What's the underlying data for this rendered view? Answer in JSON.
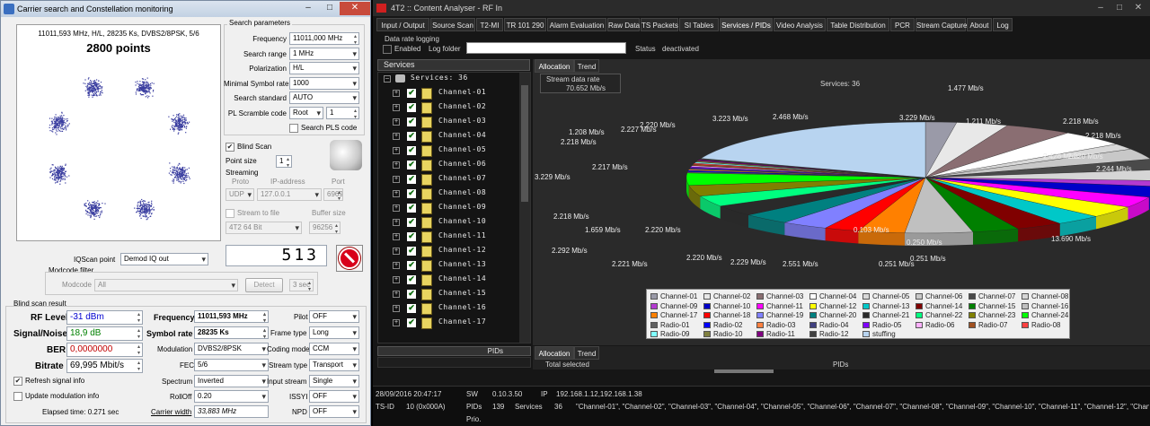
{
  "left": {
    "title": "Carrier search and Constellation monitoring",
    "constellation": {
      "header": "11011,593 MHz, H/L, 28235 Ks, DVBS2/8PSK, 5/6",
      "points_label": "2800 points"
    },
    "search_params": {
      "title": "Search parameters",
      "frequency_label": "Frequency",
      "frequency": "11011,000 MHz",
      "range_label": "Search range",
      "range": "1 MHz",
      "polarization_label": "Polarization",
      "polarization": "H/L",
      "min_sr_label": "Minimal Symbol rate",
      "min_sr": "1000",
      "standard_label": "Search standard",
      "standard": "AUTO",
      "pls_label": "PL Scramble code",
      "pls_mode": "Root",
      "pls_value": "1",
      "search_pls": "Search PLS code"
    },
    "blind_scan_label": "Blind Scan",
    "point_size_label": "Point size",
    "point_size": "1",
    "streaming": {
      "title": "Streaming",
      "proto_label": "Proto",
      "ip_label": "IP-address",
      "port_label": "Port",
      "proto": "UDP",
      "ip": "127.0.0.1",
      "port": "6969",
      "stream_to_file": "Stream to file",
      "buffer_label": "Buffer size",
      "format": "4T2 64 Bit",
      "buffer": "96256"
    },
    "counter": "513",
    "iq_label": "IQScan point",
    "iq_value": "Demod IQ out",
    "modcode": {
      "title": "Modcode filter",
      "label": "Modcode",
      "value": "All",
      "detect": "Detect",
      "interval": "3 sec"
    },
    "result": {
      "title": "Blind scan result",
      "rf_label": "RF Level",
      "rf": "-31 dBm",
      "sn_label": "Signal/Noise",
      "sn": "18,9 dB",
      "ber_label": "BER",
      "ber": "0,0000000",
      "bitrate_label": "Bitrate",
      "bitrate": "69,995 Mbit/s",
      "freq_label": "Frequency",
      "freq": "11011,593 MHz",
      "sr_label": "Symbol rate",
      "sr": "28235 Ks",
      "mod_label": "Modulation",
      "mod": "DVBS2/8PSK",
      "fec_label": "FEC",
      "fec": "5/6",
      "spectrum_label": "Spectrum",
      "spectrum": "Inverted",
      "rolloff_label": "RollOff",
      "rolloff": "0.20",
      "cw_label": "Carrier width",
      "cw": "33,883 MHz",
      "pilot_label": "Pilot",
      "pilot": "OFF",
      "frame_label": "Frame type",
      "frame": "Long",
      "coding_label": "Coding mode",
      "coding": "CCM",
      "stype_label": "Stream type",
      "stype": "Transport",
      "istream_label": "Input stream",
      "istream": "Single",
      "issyi_label": "ISSYI",
      "issyi": "OFF",
      "npd_label": "NPD",
      "npd": "OFF"
    },
    "refresh_label": "Refresh signal info",
    "update_mod_label": "Update modulation info",
    "elapsed": "Elapsed time: 0.271 sec"
  },
  "right": {
    "title": "4T2 :: Content Analyser - RF In",
    "tabs": [
      "Input / Output",
      "Source Scan",
      "T2-MI",
      "TR 101 290",
      "Alarm Evaluation",
      "Raw Data",
      "TS Packets",
      "SI Tables",
      "Services / PIDs",
      "Video Analysis",
      "Table Distribution",
      "PCR",
      "Stream Capture",
      "About",
      "Log"
    ],
    "logging": {
      "title": "Data rate logging",
      "enabled": "Enabled",
      "folder": "Log folder",
      "status_label": "Status",
      "status": "deactivated"
    },
    "services_header": "Services",
    "services_root": "Services: 36",
    "channels": [
      "Channel-01",
      "Channel-02",
      "Channel-03",
      "Channel-04",
      "Channel-05",
      "Channel-06",
      "Channel-07",
      "Channel-08",
      "Channel-09",
      "Channel-10",
      "Channel-11",
      "Channel-12",
      "Channel-13",
      "Channel-14",
      "Channel-15",
      "Channel-16",
      "Channel-17"
    ],
    "pids_header": "PIDs",
    "subtabs": [
      "Allocation",
      "Trend"
    ],
    "stream_rate_label": "Stream data rate",
    "stream_rate": "70.652 Mb/s",
    "services_count": "Services: 36",
    "total_selected": "Total selected",
    "pids_col": "PIDs",
    "pie_labels": [
      "1.477 Mb/s",
      "2.468 Mb/s",
      "3.229 Mb/s",
      "3.223 Mb/s",
      "1.211 Mb/s",
      "2.218 Mb/s",
      "2.220 Mb/s",
      "2.227 Mb/s",
      "1.208 Mb/s",
      "2.218 Mb/s",
      "2.218 Mb/s",
      "2.426 Mb/s",
      "2.220 Mb/s",
      "2.244 Mb/s",
      "2.217 Mb/s",
      "3.229 Mb/s",
      "2.218 Mb/s",
      "1.659 Mb/s",
      "2.220 Mb/s",
      "0.103 Mb/s",
      "0.250 Mb/s",
      "2.292 Mb/s",
      "13.690 Mb/s",
      "2.220 Mb/s",
      "0.251 Mb/s",
      "2.221 Mb/s",
      "2.229 Mb/s",
      "2.551 Mb/s",
      "0.251 Mb/s"
    ],
    "legend": [
      "Channel-01",
      "Channel-02",
      "Channel-03",
      "Channel-04",
      "Channel-05",
      "Channel-06",
      "Channel-07",
      "Channel-08",
      "Channel-09",
      "Channel-10",
      "Channel-11",
      "Channel-12",
      "Channel-13",
      "Channel-14",
      "Channel-15",
      "Channel-16",
      "Channel-17",
      "Channel-18",
      "Channel-19",
      "Channel-20",
      "Channel-21",
      "Channel-22",
      "Channel-23",
      "Channel-24",
      "Radio-01",
      "Radio-02",
      "Radio-03",
      "Radio-04",
      "Radio-05",
      "Radio-06",
      "Radio-07",
      "Radio-08",
      "Radio-09",
      "Radio-10",
      "Radio-11",
      "Radio-12",
      "stuffing"
    ],
    "legend_colors": [
      "#9a9aa8",
      "#e8e8e8",
      "#8a6e72",
      "#ffffff",
      "#d8d8d8",
      "#c8c8c8",
      "#4a4a4a",
      "#d6d6d6",
      "#b33ad0",
      "#0000c8",
      "#ff00ff",
      "#ffff00",
      "#00c8c8",
      "#800000",
      "#008000",
      "#c0c0c0",
      "#ff8000",
      "#ff0000",
      "#8080ff",
      "#008080",
      "#2a2a2a",
      "#00ff80",
      "#808000",
      "#00ff00",
      "#606060",
      "#0000ff",
      "#ff8040",
      "#404080",
      "#8000ff",
      "#ffb0ff",
      "#a05020",
      "#ff4040",
      "#80ffff",
      "#808040",
      "#800080",
      "#404040",
      "#b8d4f0"
    ],
    "status": {
      "date": "28/09/2016 20:47:17",
      "sw_label": "SW",
      "sw": "0.10.3.50",
      "ip_label": "IP",
      "ip": "192.168.1.12,192.168.1.38",
      "tsid_label": "TS-ID",
      "tsid": "10 (0x000A)",
      "pids_label": "PIDs",
      "pids": "139",
      "services_label": "Services",
      "services": "36",
      "services_list": "\"Channel-01\", \"Channel-02\", \"Channel-03\", \"Channel-04\", \"Channel-05\", \"Channel-06\", \"Channel-07\", \"Channel-08\", \"Channel-09\", \"Channel-10\", \"Channel-11\", \"Channel-12\", \"Chann",
      "prio_label": "Prio."
    }
  }
}
